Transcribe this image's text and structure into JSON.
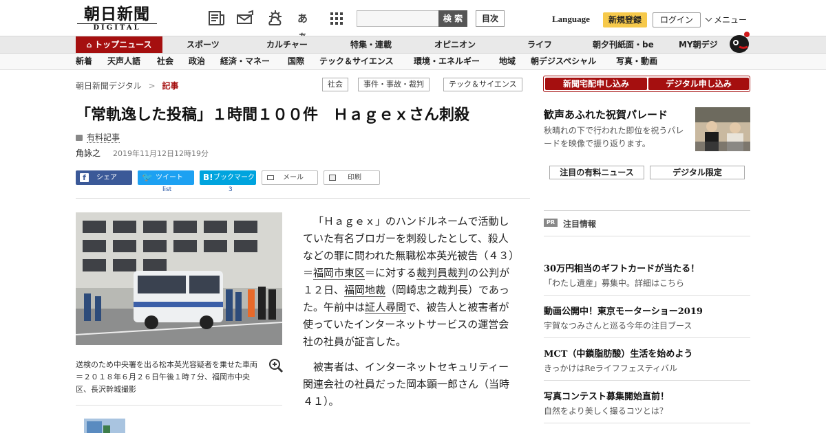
{
  "header": {
    "logo_jp": "朝日新聞",
    "logo_en": "DIGITAL",
    "search_button": "検 索",
    "index_button": "目次",
    "language": "Language",
    "register": "新規登録",
    "login": "ログイン",
    "menu": "メニュー",
    "font_size_icon_text": "あぁ"
  },
  "nav_primary": {
    "home": "トップニュース",
    "items": [
      "スポーツ",
      "カルチャー",
      "特集・連載",
      "オピニオン",
      "ライフ",
      "朝夕刊紙面・be",
      "MY朝デジ"
    ]
  },
  "nav_secondary": {
    "items": [
      "新着",
      "天声人語",
      "社会",
      "政治",
      "経済・マネー",
      "国際",
      "テック＆サイエンス",
      "環境・エネルギー",
      "地域",
      "朝デジスペシャル",
      "写真・動画"
    ]
  },
  "breadcrumb": {
    "root": "朝日新聞デジタル",
    "sep": ">",
    "current": "記事"
  },
  "tags": [
    "社会",
    "事件・事故・裁判",
    "テック＆サイエンス"
  ],
  "article": {
    "title": "「常軌逸した投稿」１時間１００件　Ｈａｇｅｘさん刺殺",
    "paid_label": "有料記事",
    "author": "角詠之",
    "date": "2019年11月12日12時19分",
    "share": {
      "facebook": "シェア",
      "twitter": "ツイート",
      "twitter_count": "list",
      "hatena": "ブックマーク",
      "hatena_count": "3",
      "mail": "メール",
      "print": "印刷"
    },
    "caption": "送検のため中央署を出る松本英光容疑者を乗せた車両＝２０１８年６月２６日午後１時７分、福岡市中央区、長沢幹城撮影",
    "body": {
      "p1_a": "「Ｈａｇｅｘ」のハンドルネームで活動していた有名ブロガーを刺殺したとして、殺人などの罪に問われた無職松本英光被告（４３）＝",
      "p1_link1": "福岡市東区",
      "p1_b": "＝に対する",
      "p1_link2": "裁判員裁判",
      "p1_c": "の公判が１２日、",
      "p1_link3": "福岡地裁",
      "p1_d": "（岡崎忠之裁判長）であった。午前中は",
      "p1_link4": "証人尋問",
      "p1_e": "で、被告人と被害者が使っていたインターネットサービスの運営会社の社員が証言した。",
      "p2": "被害者は、インターネットセキュリティー関連会社の社員だった岡本顕一郎さん（当時４１）。"
    }
  },
  "sidebar": {
    "apply_delivery": "新聞宅配申し込み",
    "apply_digital": "デジタル申し込み",
    "parade_title": "歓声あふれた祝賀パレード",
    "parade_text": "秋晴れの下で行われた即位を祝うパレードを映像で振り返ります。",
    "paid_news_button": "注目の有料ニュース",
    "digital_only_button": "デジタル限定",
    "pr_badge": "PR",
    "pr_heading": "注目情報",
    "pr_items": [
      {
        "title": "30万円相当のギフトカードが当たる！",
        "text": "「わたし遺産」募集中。詳細はこちら"
      },
      {
        "title": "動画公開中！東京モーターショー2019",
        "text": "宇賀なつみさんと巡る今年の注目ブース"
      },
      {
        "title": "MCT（中鎖脂肪酸）生活を始めよう",
        "text": "きっかけはReライフフェスティバル"
      },
      {
        "title": "写真コンテスト募集開始直前！",
        "text": "自然をより美しく撮るコツとは？"
      }
    ]
  },
  "colors": {
    "brand_red": "#a50f0f",
    "register_yellow": "#f6c94b",
    "facebook": "#3b5998",
    "twitter": "#1da1f2",
    "hatena": "#00a4de"
  }
}
